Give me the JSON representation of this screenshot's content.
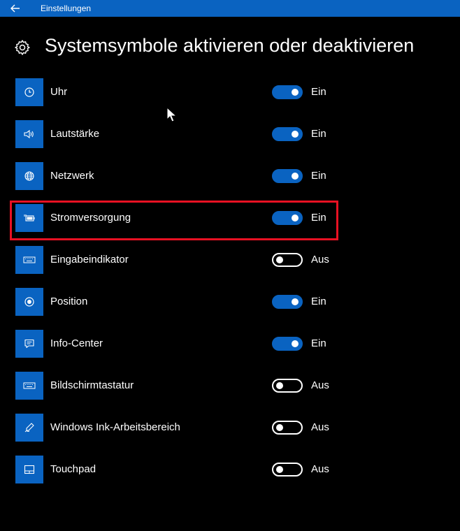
{
  "titlebar": {
    "title": "Einstellungen",
    "back_icon": "arrow-left-icon",
    "color": "#0a63c1"
  },
  "header": {
    "icon": "gear-icon",
    "title": "Systemsymbole aktivieren oder deaktivieren"
  },
  "colors": {
    "accent": "#0a63c1",
    "background": "#000000",
    "highlight": "#e81123"
  },
  "items": [
    {
      "label": "Uhr",
      "icon": "clock-icon",
      "on": true,
      "state": "Ein"
    },
    {
      "label": "Lautstärke",
      "icon": "speaker-icon",
      "on": true,
      "state": "Ein"
    },
    {
      "label": "Netzwerk",
      "icon": "globe-icon",
      "on": true,
      "state": "Ein"
    },
    {
      "label": "Stromversorgung",
      "icon": "battery-plug-icon",
      "on": true,
      "state": "Ein"
    },
    {
      "label": "Eingabeindikator",
      "icon": "keyboard-icon",
      "on": false,
      "state": "Aus"
    },
    {
      "label": "Position",
      "icon": "location-icon",
      "on": true,
      "state": "Ein"
    },
    {
      "label": "Info-Center",
      "icon": "message-icon",
      "on": true,
      "state": "Ein"
    },
    {
      "label": "Bildschirmtastatur",
      "icon": "keyboard-icon",
      "on": false,
      "state": "Aus"
    },
    {
      "label": "Windows Ink-Arbeitsbereich",
      "icon": "pen-icon",
      "on": false,
      "state": "Aus"
    },
    {
      "label": "Touchpad",
      "icon": "touchpad-icon",
      "on": false,
      "state": "Aus"
    }
  ]
}
